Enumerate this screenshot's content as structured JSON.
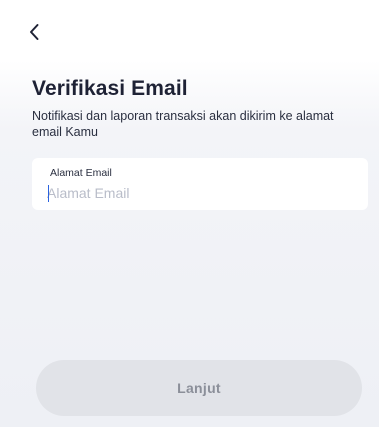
{
  "header": {
    "back_icon": "chevron-left-icon"
  },
  "page": {
    "title": "Verifikasi Email",
    "subtitle": "Notifikasi dan laporan transaksi akan dikirim ke alamat email Kamu"
  },
  "email_field": {
    "label": "Alamat Email",
    "placeholder": "Alamat Email",
    "value": ""
  },
  "actions": {
    "continue_label": "Lanjut",
    "continue_enabled": false
  },
  "colors": {
    "title": "#1e2235",
    "button_bg": "#e1e3e8",
    "button_text": "#8b8f99",
    "caret": "#2b63e0"
  }
}
